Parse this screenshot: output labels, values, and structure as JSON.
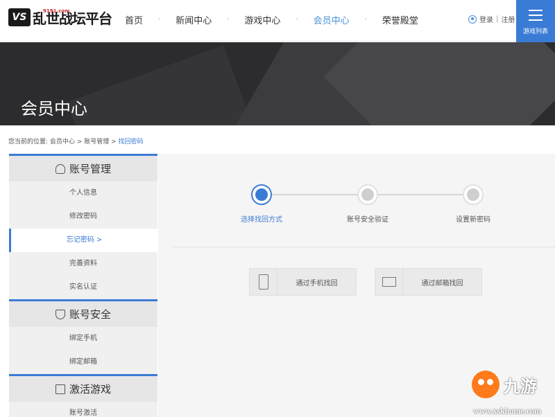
{
  "header": {
    "logo_text": "乱世战坛平台",
    "logo_sub": "9191.com",
    "nav": [
      {
        "label": "首页"
      },
      {
        "label": "新闻中心"
      },
      {
        "label": "游戏中心"
      },
      {
        "label": "会员中心",
        "active": true
      },
      {
        "label": "荣誉殿堂"
      }
    ],
    "nav_separator": "·",
    "login": "登录",
    "register": "注册",
    "divider": "|",
    "game_list": "游戏列表"
  },
  "banner": {
    "title": "会员中心"
  },
  "breadcrumb": {
    "prefix": "您当前的位置:",
    "items": [
      "会员中心",
      "账号管理"
    ],
    "current": "找回密码",
    "separator": ">"
  },
  "sidebar": {
    "sections": [
      {
        "title": "账号管理",
        "icon": "person-icon",
        "items": [
          {
            "label": "个人信息"
          },
          {
            "label": "修改密码"
          },
          {
            "label": "忘记密码 >",
            "active": true
          },
          {
            "label": "完善资料"
          },
          {
            "label": "实名认证"
          }
        ]
      },
      {
        "title": "账号安全",
        "icon": "shield-icon",
        "items": [
          {
            "label": "绑定手机"
          },
          {
            "label": "绑定邮箱"
          }
        ]
      },
      {
        "title": "激活游戏",
        "icon": "edit-doc-icon",
        "items": [
          {
            "label": "账号激活"
          }
        ]
      }
    ]
  },
  "steps": [
    {
      "label": "选择找回方式",
      "active": true
    },
    {
      "label": "账号安全验证",
      "active": false
    },
    {
      "label": "设置新密码",
      "active": false
    }
  ],
  "methods": [
    {
      "label": "通过手机找回",
      "icon": "phone-icon"
    },
    {
      "label": "通过邮箱找回",
      "icon": "mail-icon"
    }
  ],
  "watermark": {
    "text": "九游",
    "url": "www.xskhome.com"
  },
  "colors": {
    "accent": "#3a7bd5",
    "banner": "#2c2c2e"
  }
}
